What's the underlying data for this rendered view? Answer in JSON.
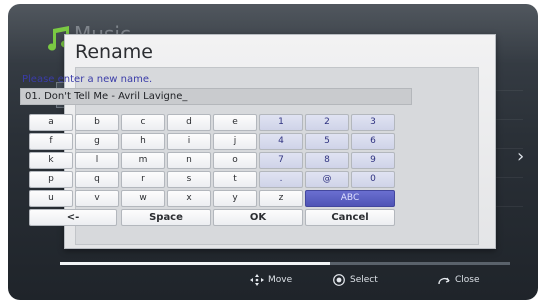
{
  "background": {
    "app_title": "Music"
  },
  "dialog": {
    "title": "Rename",
    "prompt": "Please enter a new name.",
    "input_value": "01. Don't Tell Me - Avril Lavigne_"
  },
  "keyboard": {
    "rows": [
      [
        "a",
        "b",
        "c",
        "d",
        "e",
        "1",
        "2",
        "3"
      ],
      [
        "f",
        "g",
        "h",
        "i",
        "j",
        "4",
        "5",
        "6"
      ],
      [
        "k",
        "l",
        "m",
        "n",
        "o",
        "7",
        "8",
        "9"
      ],
      [
        "p",
        "q",
        "r",
        "s",
        "t",
        ".",
        "@",
        "0"
      ],
      [
        "u",
        "v",
        "w",
        "x",
        "y",
        "z",
        "ABC"
      ]
    ],
    "bottom": {
      "backspace": "<-",
      "space": "Space",
      "ok": "OK",
      "cancel": "Cancel"
    }
  },
  "footer": {
    "move": "Move",
    "select": "Select",
    "close": "Close"
  },
  "colors": {
    "accent_note": "#7ac943",
    "digit_text": "#2f3280",
    "abc_key": "#5358bd",
    "prompt_text": "#3a3ca8"
  }
}
